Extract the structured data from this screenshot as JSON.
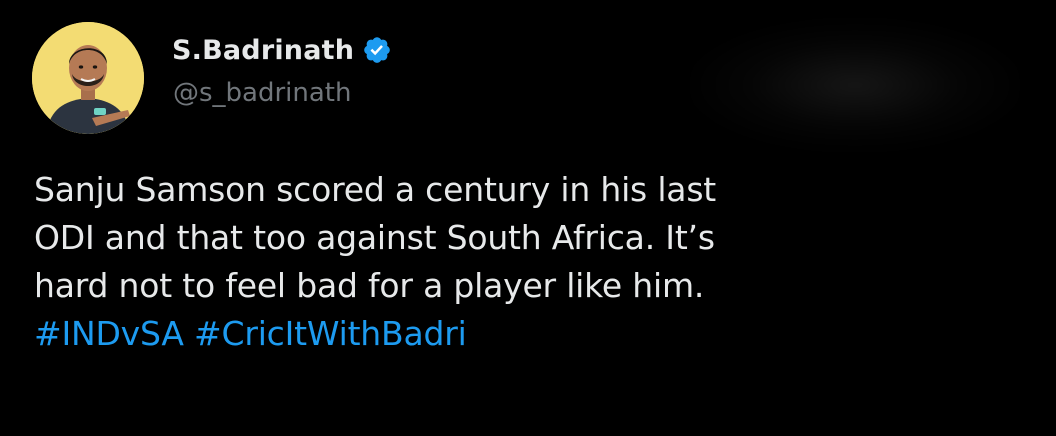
{
  "author": {
    "display_name": "S.Badrinath",
    "handle": "@s_badrinath",
    "verified": true,
    "avatar_bg_color": "#f3dc73"
  },
  "tweet": {
    "text_lines": [
      "Sanju Samson scored a century in his last",
      "ODI and that too against South Africa. It’s",
      "hard not to feel bad for a player like him."
    ],
    "hashtags": [
      "#INDvSA",
      "#CricItWithBadri"
    ]
  },
  "colors": {
    "background": "#000000",
    "primary_text": "#e7e9ea",
    "secondary_text": "#71767b",
    "link": "#1d9bf0",
    "verified_badge": "#1d9bf0"
  },
  "icons": {
    "verified": "verified-badge-icon"
  }
}
